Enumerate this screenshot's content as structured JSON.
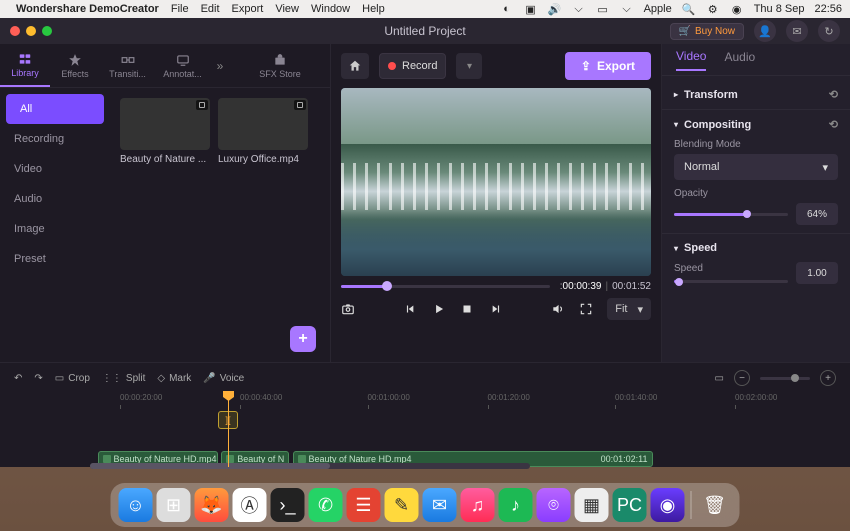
{
  "menubar": {
    "app_name": "Wondershare DemoCreator",
    "items": [
      "File",
      "Edit",
      "Export",
      "View",
      "Window",
      "Help"
    ],
    "right_app": "Apple",
    "date": "Thu 8 Sep",
    "time": "22:56"
  },
  "titlebar": {
    "project_title": "Untitled Project",
    "buy_now": "Buy Now"
  },
  "toptabs": {
    "t0": "Library",
    "t1": "Effects",
    "t2": "Transiti...",
    "t3": "Annotat...",
    "t4": "SFX Store"
  },
  "sidecats": {
    "c0": "All",
    "c1": "Recording",
    "c2": "Video",
    "c3": "Audio",
    "c4": "Image",
    "c5": "Preset"
  },
  "thumbs": {
    "t0": "Beauty of Nature ...",
    "t1": "Luxury Office.mp4"
  },
  "topbar": {
    "record": "Record",
    "export": "Export"
  },
  "playback": {
    "current": "00:00:39",
    "total": "00:01:52",
    "fit": "Fit"
  },
  "rightpanel": {
    "tab_video": "Video",
    "tab_audio": "Audio",
    "transform": "Transform",
    "compositing": "Compositing",
    "blending_mode": "Blending Mode",
    "blending_value": "Normal",
    "opacity": "Opacity",
    "opacity_val": "64%",
    "speed": "Speed",
    "speed_label": "Speed",
    "speed_val": "1.00"
  },
  "timeline": {
    "crop": "Crop",
    "split": "Split",
    "mark": "Mark",
    "voice": "Voice",
    "ticks": [
      "00:00:20:00",
      "00:00:40:00",
      "00:01:00:00",
      "00:01:20:00",
      "00:01:40:00",
      "00:02:00:00"
    ],
    "inout": "][",
    "clip1": "Beauty of Nature HD.mp4",
    "clip2": "Beauty of N",
    "clip3": "Beauty of Nature HD.mp4",
    "clip3_dur": "00:01:02:11"
  },
  "dock": {
    "icons": [
      "finder",
      "launchpad",
      "firefox",
      "ai",
      "terminal",
      "whatsapp",
      "todoist",
      "notes",
      "mail",
      "music",
      "spotify",
      "podcasts",
      "chess",
      "pycharm",
      "democreator",
      "",
      "trash"
    ]
  }
}
